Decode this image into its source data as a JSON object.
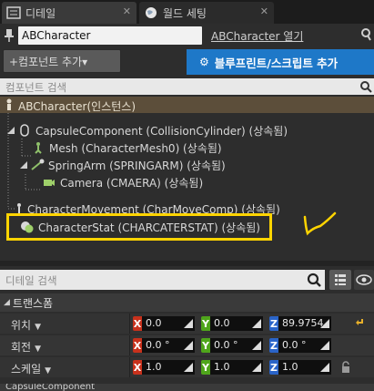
{
  "tabs": [
    {
      "label": "디테일",
      "icon": "details-icon"
    },
    {
      "label": "월드 세팅",
      "icon": "globe-icon"
    }
  ],
  "blueprint": {
    "name": "ABCharacter",
    "open_link": "ABCharacter 열기"
  },
  "toolbar": {
    "add_component_label": "+컴포넌트 추가▾",
    "blueprint_script_label": "블루프린트/스크립트 추가"
  },
  "component_search": {
    "placeholder": "컴포넌트 검색"
  },
  "components": {
    "root": "ABCharacter(인스턴스)",
    "items": [
      {
        "label": "CapsuleComponent (CollisionCylinder) (상속됨)",
        "icon": "capsule-icon"
      },
      {
        "label": "Mesh (CharacterMesh0) (상속됨)",
        "icon": "mesh-icon"
      },
      {
        "label": "SpringArm (SPRINGARM) (상속됨)",
        "icon": "springarm-icon"
      },
      {
        "label": "Camera (CMAERA) (상속됨)",
        "icon": "camera-icon"
      },
      {
        "label": "CharacterMovement (CharMoveComp) (상속됨)",
        "icon": "movement-icon"
      },
      {
        "label": "CharacterStat (CHARCATERSTAT) (상속됨)",
        "icon": "stat-component-icon"
      }
    ]
  },
  "detail_search": {
    "placeholder": "디테일 검색"
  },
  "transform": {
    "section_title": "트랜스폼",
    "rows": [
      {
        "label": "위치",
        "x": "0.0",
        "y": "0.0",
        "z": "89.9754"
      },
      {
        "label": "회전",
        "x": "0.0 °",
        "y": "0.0 °",
        "z": "0.0 °"
      },
      {
        "label": "스케일",
        "x": "1.0",
        "y": "1.0",
        "z": "1.0"
      }
    ]
  },
  "next_section": "CapsuleComponent",
  "colors": {
    "accent_blue": "#1e78c8",
    "highlight_yellow": "#ffd400",
    "axis_x": "#c8311c",
    "axis_y": "#4fa51b",
    "axis_z": "#2a64c8"
  }
}
